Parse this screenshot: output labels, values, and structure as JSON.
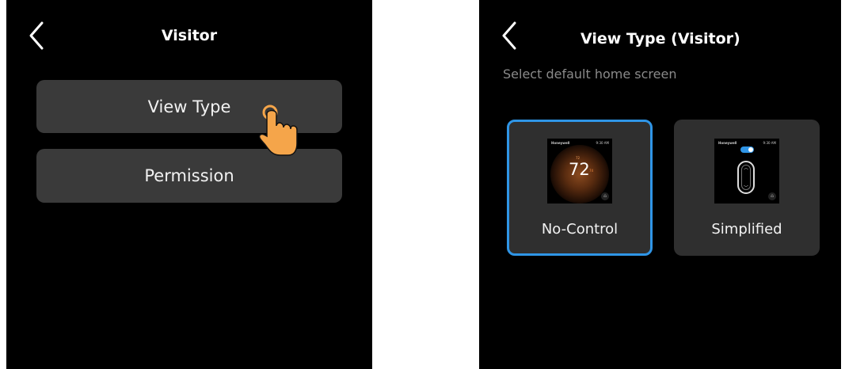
{
  "left_screen": {
    "title": "Visitor",
    "buttons": [
      {
        "label": "View Type"
      },
      {
        "label": "Permission"
      }
    ]
  },
  "right_screen": {
    "title": "View Type (Visitor)",
    "subtitle": "Select default home screen",
    "options": [
      {
        "label": "No-Control",
        "selected": true,
        "preview": {
          "brand": "Honeywell",
          "time": "9:30 AM",
          "setpoint": "72",
          "temperature": "72",
          "outdoor": "74"
        }
      },
      {
        "label": "Simplified",
        "selected": false,
        "preview": {
          "brand": "Honeywell",
          "time": "9:30 AM"
        }
      }
    ]
  },
  "colors": {
    "background": "#000000",
    "button": "#3a3a3a",
    "selected_border": "#2f95e6",
    "subtitle": "#8a8a8a",
    "pointer_hand": "#f5a54a"
  },
  "icons": {
    "back": "chevron-left-icon",
    "tap": "pointing-hand-icon",
    "home": "home-icon"
  }
}
